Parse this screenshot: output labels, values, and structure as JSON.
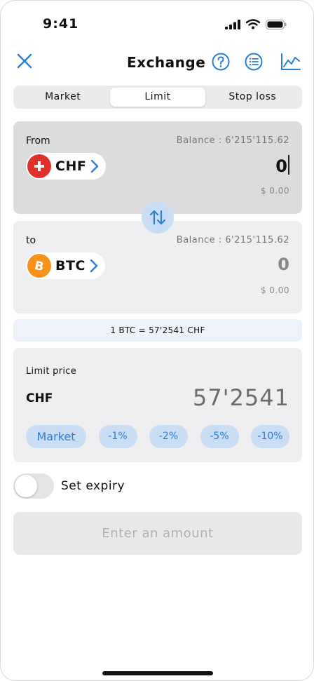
{
  "status": {
    "time": "9:41"
  },
  "header": {
    "title": "Exchange"
  },
  "tabs": [
    {
      "label": "Market",
      "active": false
    },
    {
      "label": "Limit",
      "active": true
    },
    {
      "label": "Stop loss",
      "active": false
    }
  ],
  "from": {
    "label": "From",
    "balance": "Balance : 6'215'115.62",
    "currency": "CHF",
    "amount": "0",
    "fiat": "$ 0.00"
  },
  "to": {
    "label": "to",
    "balance": "Balance : 6'215'115.62",
    "currency": "BTC",
    "amount": "0",
    "fiat": "$ 0.00"
  },
  "rate": "1 BTC = 57'2541 CHF",
  "limit": {
    "label": "Limit price",
    "currency": "CHF",
    "price": "57'2541",
    "chips": [
      "Market",
      "-1%",
      "-2%",
      "-5%",
      "-10%"
    ]
  },
  "expiry": {
    "label": "Set expiry",
    "enabled": false
  },
  "cta": {
    "label": "Enter an amount"
  },
  "colors": {
    "accent": "#2b7fd4",
    "chip_bg": "#c9ddf5",
    "swiss_red": "#e0302c",
    "bitcoin_orange": "#f7931a"
  },
  "icons": {
    "close": "close-icon",
    "help": "help-icon",
    "orders": "list-icon",
    "chart": "chart-icon",
    "swap": "swap-arrows-icon",
    "chf_flag": "swiss-flag-icon",
    "btc": "bitcoin-icon"
  }
}
